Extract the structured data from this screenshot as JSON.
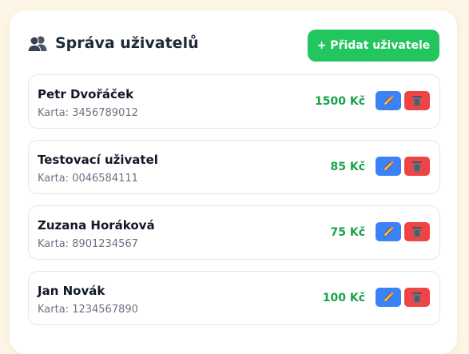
{
  "header": {
    "title": "Správa uživatelů",
    "icon": "users-icon",
    "add_button_label": "+ Přidat uživatele"
  },
  "users": [
    {
      "name": "Petr Dvořáček",
      "card_label": "Karta:",
      "card": "3456789012",
      "amount": "1500 Kč"
    },
    {
      "name": "Testovací uživatel",
      "card_label": "Karta:",
      "card": "0046584111",
      "amount": "85 Kč"
    },
    {
      "name": "Zuzana Horáková",
      "card_label": "Karta:",
      "card": "8901234567",
      "amount": "75 Kč"
    },
    {
      "name": "Jan Novák",
      "card_label": "Karta:",
      "card": "1234567890",
      "amount": "100 Kč"
    }
  ],
  "colors": {
    "accent_green": "#22c55e",
    "amount_green": "#16a34a",
    "edit_blue": "#3b82f6",
    "delete_red": "#ef4444",
    "page_background": "#fdf6e6"
  },
  "icons": {
    "edit": "pencil-icon",
    "delete": "trash-icon"
  }
}
